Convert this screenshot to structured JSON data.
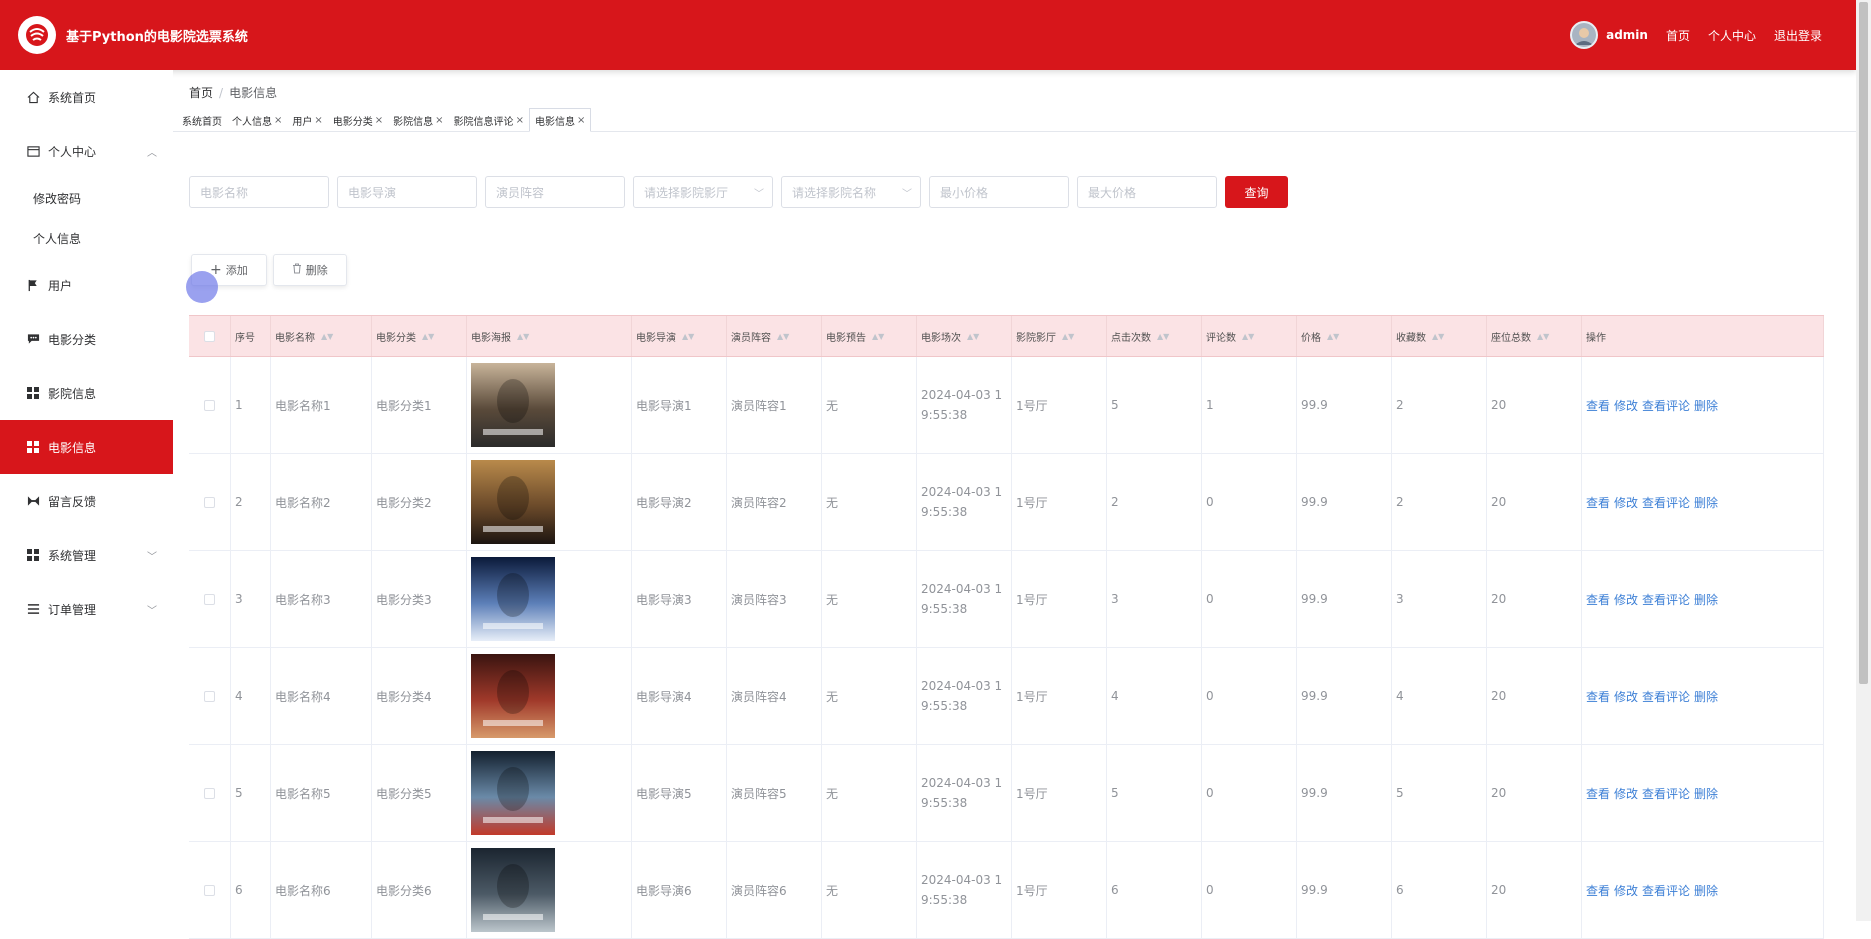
{
  "header": {
    "title": "基于Python的电影院选票系统",
    "username": "admin",
    "nav": [
      "首页",
      "个人中心",
      "退出登录"
    ]
  },
  "sidebar": {
    "items": [
      {
        "label": "系统首页",
        "icon": "home-icon"
      },
      {
        "label": "个人中心",
        "icon": "user-card-icon",
        "expanded": true,
        "children": [
          "修改密码",
          "个人信息"
        ]
      },
      {
        "label": "用户",
        "icon": "flag-icon"
      },
      {
        "label": "电影分类",
        "icon": "chat-icon"
      },
      {
        "label": "影院信息",
        "icon": "grid-icon"
      },
      {
        "label": "电影信息",
        "icon": "grid-icon",
        "active": true
      },
      {
        "label": "留言反馈",
        "icon": "feedback-icon"
      },
      {
        "label": "系统管理",
        "icon": "grid-icon",
        "collapsible": true
      },
      {
        "label": "订单管理",
        "icon": "list-icon",
        "collapsible": true
      }
    ]
  },
  "breadcrumb": {
    "home": "首页",
    "current": "电影信息"
  },
  "tags": [
    {
      "label": "系统首页",
      "closable": false
    },
    {
      "label": "个人信息",
      "closable": true
    },
    {
      "label": "用户",
      "closable": true
    },
    {
      "label": "电影分类",
      "closable": true
    },
    {
      "label": "影院信息",
      "closable": true
    },
    {
      "label": "影院信息评论",
      "closable": true
    },
    {
      "label": "电影信息",
      "closable": true,
      "active": true
    }
  ],
  "search": {
    "fields": [
      {
        "placeholder": "电影名称",
        "type": "input"
      },
      {
        "placeholder": "电影导演",
        "type": "input"
      },
      {
        "placeholder": "演员阵容",
        "type": "input"
      },
      {
        "placeholder": "请选择影院影厅",
        "type": "select"
      },
      {
        "placeholder": "请选择影院名称",
        "type": "select"
      },
      {
        "placeholder": "最小价格",
        "type": "input"
      },
      {
        "placeholder": "最大价格",
        "type": "input"
      }
    ],
    "button": "查询"
  },
  "actions": {
    "add": "添加",
    "delete": "删除"
  },
  "table": {
    "columns": [
      "序号",
      "电影名称",
      "电影分类",
      "电影海报",
      "电影导演",
      "演员阵容",
      "电影预告",
      "电影场次",
      "影院影厅",
      "点击次数",
      "评论数",
      "价格",
      "收藏数",
      "座位总数",
      "操作"
    ],
    "sortable": [
      false,
      true,
      true,
      true,
      true,
      true,
      true,
      true,
      true,
      true,
      true,
      true,
      true,
      true,
      false
    ],
    "rows": [
      {
        "no": "1",
        "name": "电影名称1",
        "category": "电影分类1",
        "director": "电影导演1",
        "cast": "演员阵容1",
        "trailer": "无",
        "showtime": "2024-04-03 19:55:38",
        "hall": "1号厅",
        "clicks": "5",
        "comments": "1",
        "price": "99.9",
        "favorites": "2",
        "seats": "20",
        "poster": "poster-1"
      },
      {
        "no": "2",
        "name": "电影名称2",
        "category": "电影分类2",
        "director": "电影导演2",
        "cast": "演员阵容2",
        "trailer": "无",
        "showtime": "2024-04-03 19:55:38",
        "hall": "1号厅",
        "clicks": "2",
        "comments": "0",
        "price": "99.9",
        "favorites": "2",
        "seats": "20",
        "poster": "poster-2"
      },
      {
        "no": "3",
        "name": "电影名称3",
        "category": "电影分类3",
        "director": "电影导演3",
        "cast": "演员阵容3",
        "trailer": "无",
        "showtime": "2024-04-03 19:55:38",
        "hall": "1号厅",
        "clicks": "3",
        "comments": "0",
        "price": "99.9",
        "favorites": "3",
        "seats": "20",
        "poster": "poster-3"
      },
      {
        "no": "4",
        "name": "电影名称4",
        "category": "电影分类4",
        "director": "电影导演4",
        "cast": "演员阵容4",
        "trailer": "无",
        "showtime": "2024-04-03 19:55:38",
        "hall": "1号厅",
        "clicks": "4",
        "comments": "0",
        "price": "99.9",
        "favorites": "4",
        "seats": "20",
        "poster": "poster-4"
      },
      {
        "no": "5",
        "name": "电影名称5",
        "category": "电影分类5",
        "director": "电影导演5",
        "cast": "演员阵容5",
        "trailer": "无",
        "showtime": "2024-04-03 19:55:38",
        "hall": "1号厅",
        "clicks": "5",
        "comments": "0",
        "price": "99.9",
        "favorites": "5",
        "seats": "20",
        "poster": "poster-5"
      },
      {
        "no": "6",
        "name": "电影名称6",
        "category": "电影分类6",
        "director": "电影导演6",
        "cast": "演员阵容6",
        "trailer": "无",
        "showtime": "2024-04-03 19:55:38",
        "hall": "1号厅",
        "clicks": "6",
        "comments": "0",
        "price": "99.9",
        "favorites": "6",
        "seats": "20",
        "poster": "poster-6"
      }
    ],
    "row_actions": [
      "查看",
      "修改",
      "查看评论",
      "删除"
    ]
  },
  "colors": {
    "accent": "#d7161b",
    "link": "#3c7fd6",
    "header_row_bg": "#fbe3e5"
  }
}
